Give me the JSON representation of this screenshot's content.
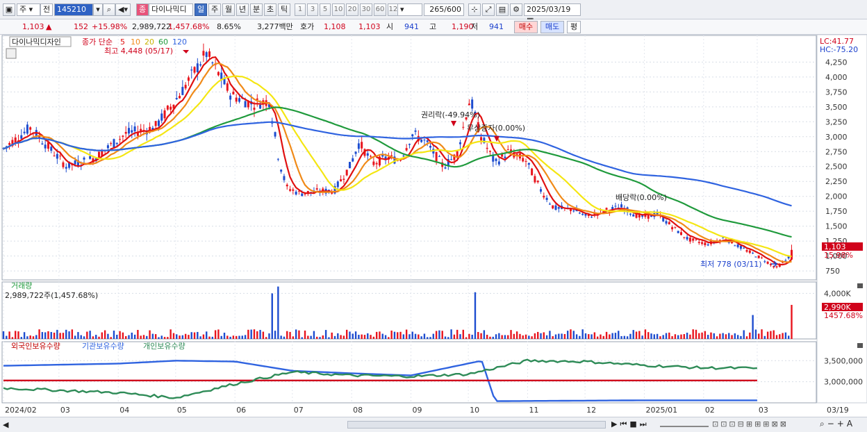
{
  "toolbar": {
    "period_label": "주",
    "scope_label": "전",
    "code_value": "145210",
    "stock_name": "다이나믹디",
    "stock_badge": "종",
    "timeframes": [
      "일",
      "주",
      "월",
      "년",
      "분",
      "초",
      "틱"
    ],
    "active_timeframe": "일",
    "minute_steps": [
      "1",
      "3",
      "5",
      "10",
      "20",
      "30",
      "60",
      "120"
    ],
    "count": "265",
    "count_total": "/600",
    "date": "2025/03/19"
  },
  "quote": {
    "price": "1,103",
    "change": "152",
    "change_pct": "+15.98%",
    "volume": "2,989,722",
    "volume_ratio": "1,457.68%",
    "turnover_rate": "8.65%",
    "amount": "3,277백만",
    "ask_label": "호가",
    "ask": "1,108",
    "bid": "1,103",
    "open_label": "시",
    "open": "941",
    "high_label": "고",
    "high": "1,190",
    "low_label": "저",
    "low": "941",
    "buy_label": "매수",
    "sell_label": "매도",
    "eval_label": "평"
  },
  "legend": {
    "name": "다이나믹디자인",
    "ma_title": "종가 단순",
    "ma_periods": [
      "5",
      "10",
      "20",
      "60",
      "120"
    ]
  },
  "annotations": {
    "high_label": "최고 4,448 (05/17)",
    "low_label": "최저 778 (03/11)",
    "rights_label": "권리락(-49.94%)",
    "capital_label": "무상증자(0.00%)",
    "dividend_label": "배당락(0.00%)"
  },
  "right_info": {
    "lc": "LC:41.77",
    "hc": "HC:-75.20",
    "price_tag": "1,103",
    "pct_tag": "15.98%",
    "vol_tag": "2,990K",
    "vol_pct_tag": "1457.68%"
  },
  "volume_panel": {
    "title": "거래량",
    "value": "2,989,722주(1,457.68%)"
  },
  "holding_panel": {
    "labels": [
      "외국인보유수량",
      "기관보유수량",
      "개인보유수량"
    ]
  },
  "x_axis_labels": [
    "2024/02",
    "03",
    "04",
    "05",
    "06",
    "07",
    "08",
    "09",
    "10",
    "11",
    "12",
    "2025/01",
    "02",
    "03",
    "03/19"
  ],
  "colors": {
    "up": "#e8141d",
    "down": "#1d4ccf",
    "ma5": "#e01010",
    "ma10": "#f08a18",
    "ma20": "#f4e612",
    "ma60": "#1f9a3c",
    "ma120": "#2f63e0",
    "foreign": "#2f63e0",
    "inst": "#d0021b",
    "indiv": "#2e8b57"
  },
  "chart_data": [
    {
      "type": "candlestick",
      "title": "다이나믹디자인",
      "period": "daily",
      "x_range": [
        "2024/02",
        "2025/03/19"
      ],
      "ylim": [
        600,
        4650
      ],
      "y_ticks": [
        750,
        1000,
        1250,
        1500,
        1750,
        2000,
        2250,
        2500,
        2750,
        3000,
        3250,
        3500,
        3750,
        4000,
        4250
      ],
      "y_tick_labels": [
        "750",
        "1,000",
        "1,250",
        "1,500",
        "1,750",
        "2,000",
        "2,250",
        "2,500",
        "2,750",
        "3,000",
        "3,250",
        "3,500",
        "3,750",
        "4,000",
        "4,250"
      ],
      "close_keypoints": {
        "x": [
          "2024/02/01",
          "2024/02/15",
          "2024/03/05",
          "2024/03/20",
          "2024/04/05",
          "2024/04/20",
          "2024/05/03",
          "2024/05/17",
          "2024/05/30",
          "2024/06/10",
          "2024/06/19",
          "2024/06/24",
          "2024/06/28",
          "2024/07/05",
          "2024/07/15",
          "2024/07/23",
          "2024/07/31",
          "2024/08/05",
          "2024/08/12",
          "2024/08/20",
          "2024/08/26",
          "2024/09/02",
          "2024/09/09",
          "2024/09/18",
          "2024/09/25",
          "2024/10/02",
          "2024/10/07",
          "2024/10/15",
          "2024/10/22",
          "2024/10/31",
          "2024/11/08",
          "2024/11/15",
          "2024/11/25",
          "2024/12/02",
          "2024/12/10",
          "2024/12/20",
          "2024/12/30",
          "2025/01/08",
          "2025/01/16",
          "2025/01/24",
          "2025/02/03",
          "2025/02/12",
          "2025/02/20",
          "2025/03/04",
          "2025/03/11",
          "2025/03/17",
          "2025/03/19"
        ],
        "y": [
          2800,
          3150,
          2500,
          2650,
          3050,
          3150,
          3700,
          4400,
          3700,
          3550,
          3600,
          2600,
          2150,
          2050,
          2080,
          2100,
          2500,
          2900,
          2550,
          2650,
          2600,
          3050,
          2900,
          2500,
          2700,
          3650,
          3050,
          2550,
          2750,
          2600,
          2100,
          1800,
          1780,
          1650,
          1750,
          1820,
          1650,
          1700,
          1480,
          1280,
          1200,
          1300,
          1150,
          950,
          800,
          951,
          1103
        ]
      },
      "moving_averages": [
        "5",
        "10",
        "20",
        "60",
        "120"
      ],
      "annotations": [
        "최고 4,448 (05/17)",
        "최저 778 (03/11)",
        "권리락(-49.94%)",
        "무상증자(0.00%)",
        "배당락(0.00%)"
      ],
      "last_price": 1103,
      "last_change_pct": 15.98,
      "legend_position": "top-left",
      "grid": true
    },
    {
      "type": "bar",
      "title": "거래량",
      "ylim": [
        0,
        5000000
      ],
      "y_ticks": [
        4000000
      ],
      "y_tick_labels": [
        "4,000K"
      ],
      "last_value": 2989722,
      "last_ratio_pct": 1457.68,
      "spikes": [
        {
          "x": "2024/06/24",
          "value": 4600000
        },
        {
          "x": "2024/06/21",
          "value": 4000000
        },
        {
          "x": "2024/10/04",
          "value": 4100000
        },
        {
          "x": "2025/02/27",
          "value": 2100000
        },
        {
          "x": "2025/03/19",
          "value": 2989722
        }
      ]
    },
    {
      "type": "line",
      "title": "외국인보유수량 · 기관보유수량 · 개인보유수량",
      "ylim": [
        2500000,
        3950000
      ],
      "y_ticks": [
        3000000,
        3500000
      ],
      "y_tick_labels": [
        "3,000,000",
        "3,500,000"
      ],
      "series": [
        {
          "name": "외국인보유수량",
          "x": [
            "2024/02",
            "2024/04",
            "2024/05",
            "2024/06",
            "2024/07",
            "2024/08",
            "2024/09",
            "2024/10/08",
            "2024/10/15",
            "2025/01",
            "2025/03"
          ],
          "values": [
            3380000,
            3430000,
            3500000,
            3480000,
            3260000,
            3200000,
            3150000,
            3500000,
            2540000,
            2560000,
            2560000
          ]
        },
        {
          "name": "기관보유수량",
          "x": [
            "2024/02",
            "2025/03"
          ],
          "values": [
            3030000,
            3030000
          ]
        },
        {
          "name": "개인보유수량",
          "x": [
            "2024/02",
            "2024/04",
            "2024/05",
            "2024/06",
            "2024/07",
            "2024/08",
            "2024/09",
            "2024/10",
            "2024/11",
            "2024/12",
            "2025/01",
            "2025/02",
            "2025/03"
          ],
          "values": [
            2850000,
            2740000,
            2620000,
            2950000,
            3230000,
            3150000,
            3130000,
            3180000,
            3500000,
            3480000,
            3390000,
            3330000,
            3320000
          ]
        }
      ]
    }
  ]
}
